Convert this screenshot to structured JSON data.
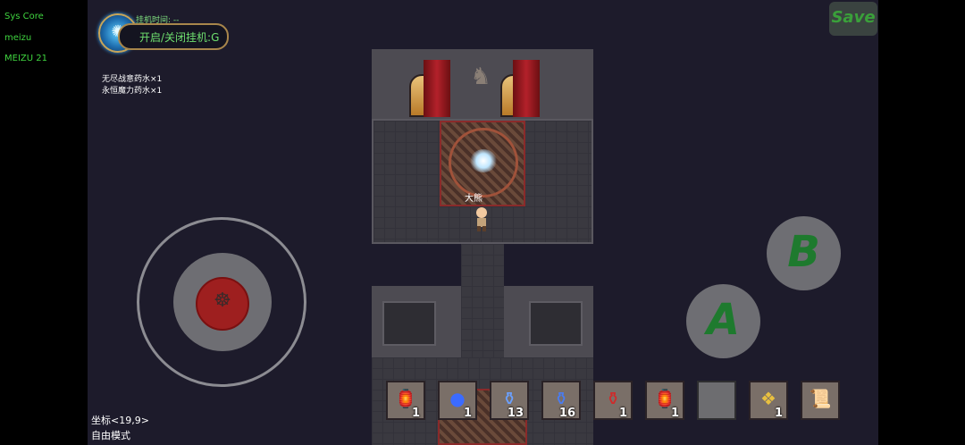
{
  "device": {
    "lines": [
      "Sys Core",
      "meizu",
      "MEIZU 21"
    ]
  },
  "hud": {
    "idle_time_label": "挂机时间: --",
    "idle_toggle_label": "开启/关闭挂机:G",
    "potions": [
      "无尽战意药水×1",
      "永恒魔力药水×1"
    ],
    "save_label": "Save",
    "coords": "坐标<19,9>",
    "mode": "自由模式"
  },
  "npc": {
    "name": "大熊"
  },
  "controls": {
    "a_label": "A",
    "b_label": "B"
  },
  "hotbar": [
    {
      "icon": "lantern-icon",
      "count": "1"
    },
    {
      "icon": "crystal-ball-icon",
      "count": "1"
    },
    {
      "icon": "blue-potion-icon",
      "count": "13"
    },
    {
      "icon": "blue-potion-icon",
      "count": "16"
    },
    {
      "icon": "red-potion-icon",
      "count": "1"
    },
    {
      "icon": "lantern-icon",
      "count": "1"
    },
    {
      "icon": "empty-slot",
      "count": ""
    },
    {
      "icon": "gold-scroll-icon",
      "count": "1"
    },
    {
      "icon": "paper-scroll-icon",
      "count": ""
    }
  ]
}
